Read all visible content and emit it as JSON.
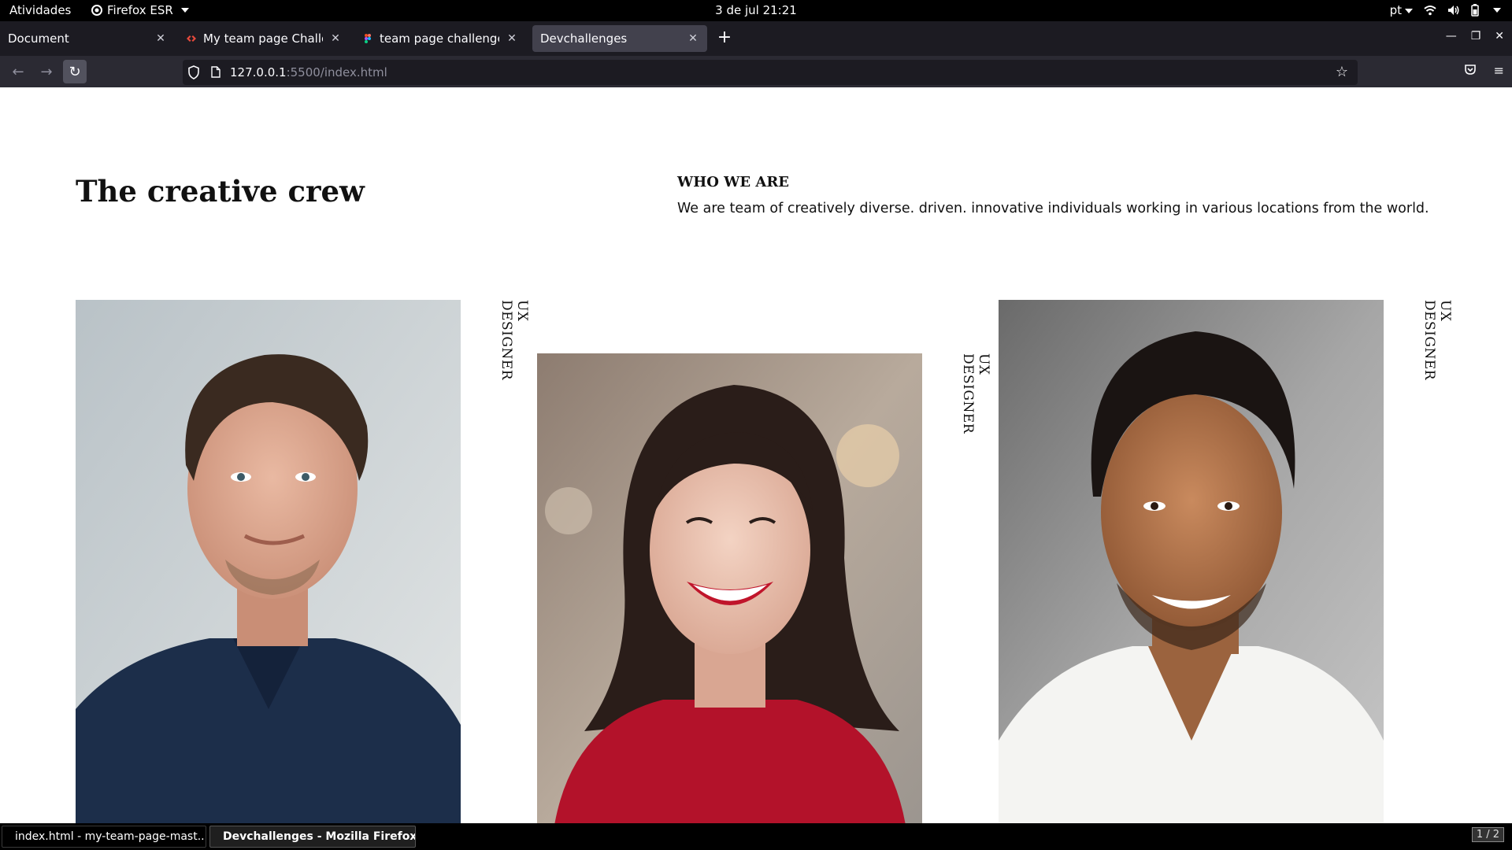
{
  "system_bar": {
    "activities": "Atividades",
    "app_name": "Firefox ESR",
    "clock": "3 de jul  21:21",
    "language": "pt"
  },
  "browser": {
    "tabs": [
      {
        "label": "Document",
        "active": false
      },
      {
        "label": "My team page Challenge | Devchallenges",
        "active": false
      },
      {
        "label": "team page challenge – Figma",
        "active": false
      },
      {
        "label": "Devchallenges",
        "active": true
      }
    ],
    "url_host": "127.0.0.1",
    "url_path": ":5500/index.html"
  },
  "page": {
    "headline": "The creative crew",
    "who_title": "WHO WE ARE",
    "who_text": "We are team of creatively diverse. driven. innovative individuals working in various locations from the world.",
    "members": [
      {
        "role": "UX DESIGNER",
        "photo": "man-navy-polo-portrait"
      },
      {
        "role": "UX DESIGNER",
        "photo": "woman-red-sweater-portrait"
      },
      {
        "role": "UX DESIGNER",
        "photo": "man-white-tshirt-portrait"
      }
    ]
  },
  "taskbar": {
    "items": [
      {
        "label": "index.html - my-team-page-mast...",
        "icon": "vscode-icon",
        "active": false
      },
      {
        "label": "Devchallenges - Mozilla Firefox",
        "icon": "firefox-icon",
        "active": true
      }
    ],
    "pager": "1 / 2"
  }
}
